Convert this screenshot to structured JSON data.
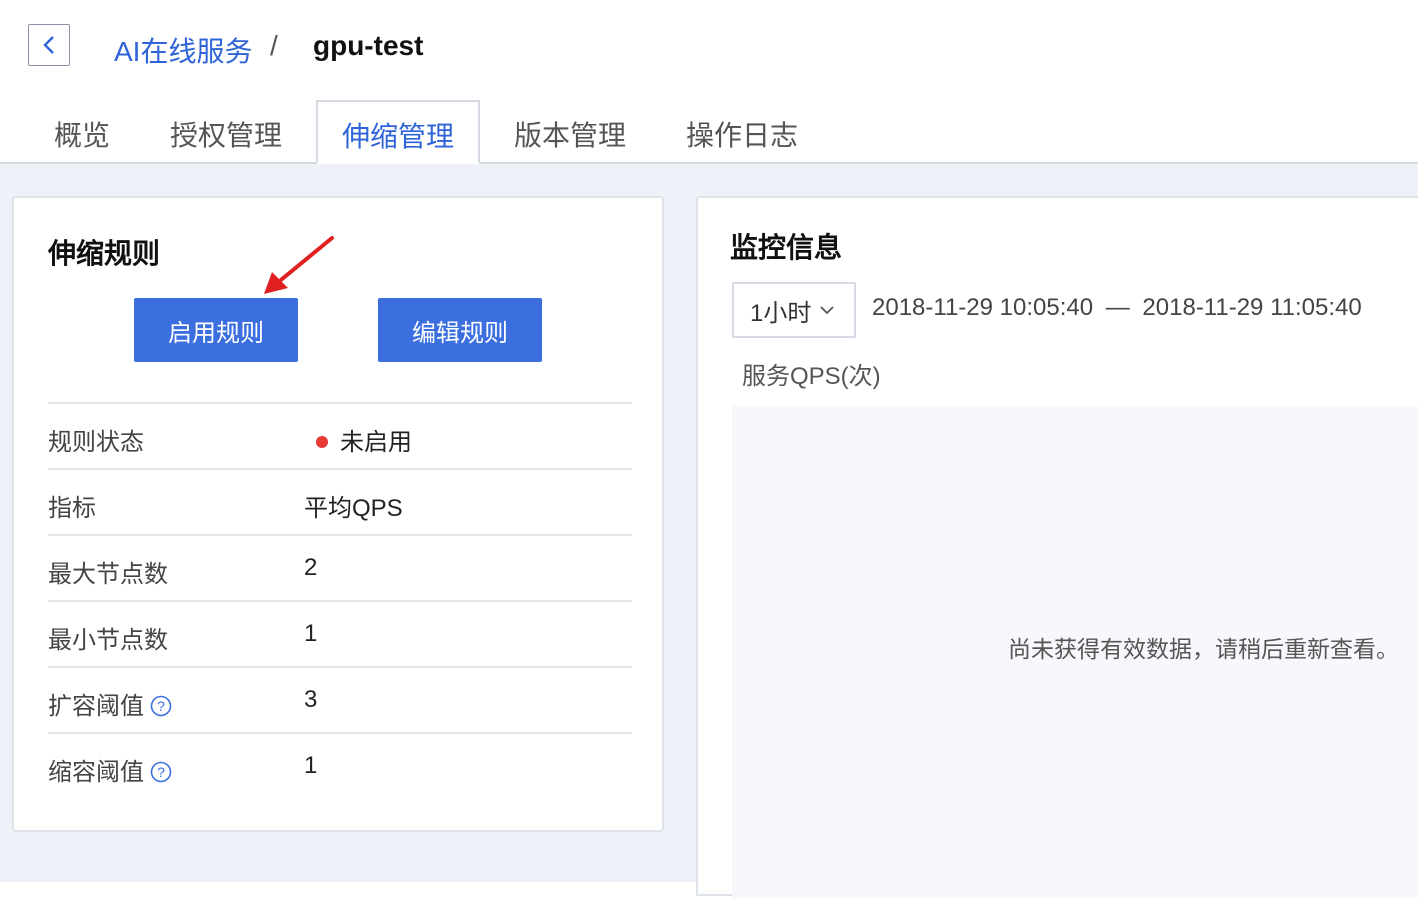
{
  "breadcrumb": {
    "parent": "AI在线服务",
    "separator": "/",
    "current": "gpu-test"
  },
  "tabs": [
    "概览",
    "授权管理",
    "伸缩管理",
    "版本管理",
    "操作日志"
  ],
  "active_tab_index": 2,
  "scaling": {
    "title": "伸缩规则",
    "enable_button": "启用规则",
    "edit_button": "编辑规则",
    "rows": [
      {
        "label": "规则状态",
        "value": "未启用",
        "status_color": "#e53935"
      },
      {
        "label": "指标",
        "value": "平均QPS"
      },
      {
        "label": "最大节点数",
        "value": "2"
      },
      {
        "label": "最小节点数",
        "value": "1"
      },
      {
        "label": "扩容阈值",
        "value": "3",
        "help": true
      },
      {
        "label": "缩容阈值",
        "value": "1",
        "help": true
      }
    ]
  },
  "monitor": {
    "title": "监控信息",
    "range_select": "1小时",
    "start_time": "2018-11-29 10:05:40",
    "range_separator": "—",
    "end_time": "2018-11-29 11:05:40",
    "chart_label": "服务QPS(次)",
    "empty_message": "尚未获得有效数据，请稍后重新查看。"
  },
  "colors": {
    "primary": "#3b6fe0",
    "link": "#2f64d8",
    "status_disabled": "#e53935",
    "annotation_arrow": "#e02020"
  },
  "icons": [
    "chevron-left-icon",
    "chevron-down-icon",
    "help-icon",
    "status-dot-icon",
    "annotation-arrow"
  ]
}
